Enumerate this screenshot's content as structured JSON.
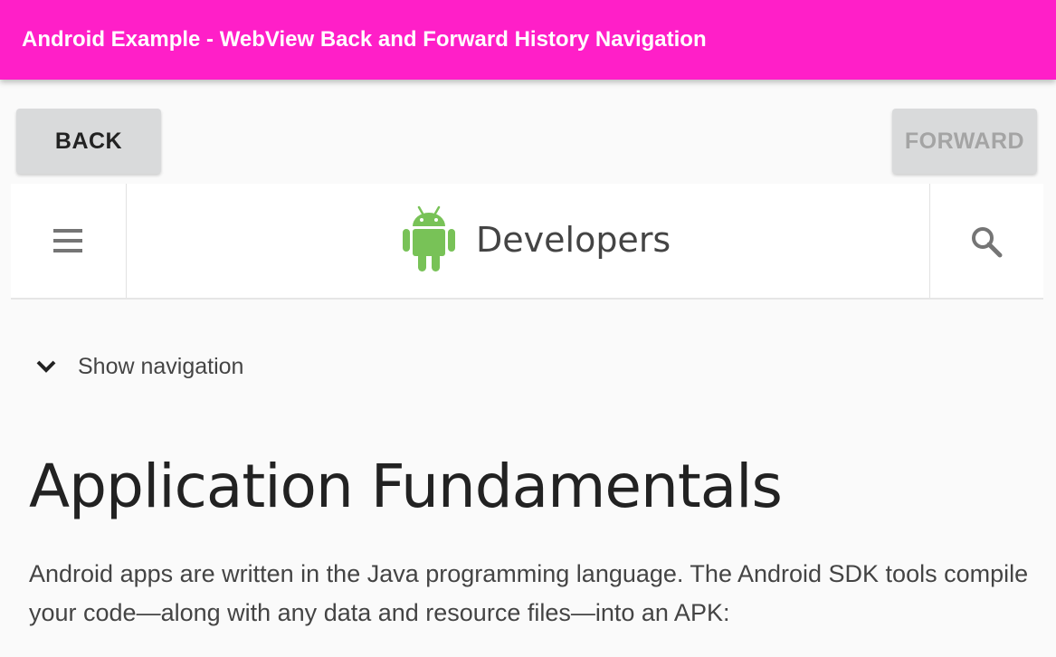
{
  "app": {
    "title": "Android Example - WebView Back and Forward History Navigation",
    "accent_color": "#ff1fc8"
  },
  "controls": {
    "back_label": "BACK",
    "forward_label": "FORWARD",
    "forward_enabled": false
  },
  "webview": {
    "header": {
      "menu_icon": "hamburger-menu-icon",
      "logo_icon": "android-robot-icon",
      "brand": "Developers",
      "search_icon": "search-icon",
      "logo_color": "#78c257"
    },
    "show_navigation_label": "Show navigation",
    "page_title": "Application Fundamentals",
    "intro_paragraph": "Android apps are written in the Java programming language. The Android SDK tools compile your code—along with any data and resource files—into an APK:"
  }
}
